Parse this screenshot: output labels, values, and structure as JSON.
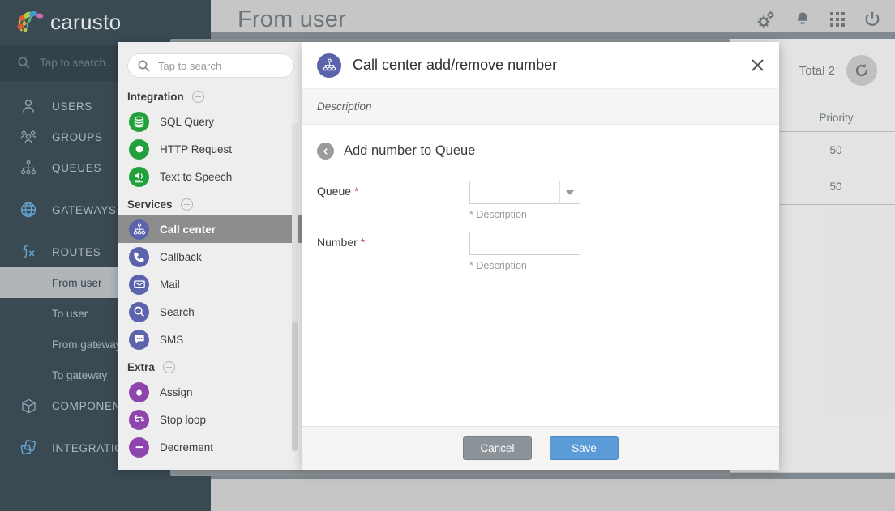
{
  "app": {
    "brand": "carusto",
    "nav_search_placeholder": "Tap to search..."
  },
  "sidebar": {
    "items": [
      {
        "label": "USERS",
        "icon": "user-icon"
      },
      {
        "label": "GROUPS",
        "icon": "group-icon"
      },
      {
        "label": "QUEUES",
        "icon": "queues-icon"
      },
      {
        "label": "GATEWAYS",
        "icon": "globe-icon"
      },
      {
        "label": "ROUTES",
        "icon": "fx-icon"
      }
    ],
    "route_children": [
      {
        "label": "From user",
        "active": true
      },
      {
        "label": "To user",
        "active": false
      },
      {
        "label": "From gateway",
        "active": false
      },
      {
        "label": "To gateway",
        "active": false
      }
    ],
    "lower_items": [
      {
        "label": "COMPONENTS",
        "icon": "cube-icon"
      },
      {
        "label": "INTEGRATION",
        "icon": "layers-icon"
      }
    ]
  },
  "page": {
    "title": "From user",
    "total_label": "Total 2",
    "refresh_icon": "refresh-icon",
    "topbar_icons": [
      "settings-gears-icon",
      "bell-icon",
      "apps-grid-icon",
      "power-icon"
    ],
    "table": {
      "column": "Priority",
      "rows": [
        "50",
        "50"
      ]
    }
  },
  "picker": {
    "search_placeholder": "Tap to search",
    "groups": [
      {
        "title": "Integration",
        "color": "#22a03c",
        "items": [
          {
            "label": "SQL Query",
            "icon": "database-icon"
          },
          {
            "label": "HTTP Request",
            "icon": "circle-dot-icon"
          },
          {
            "label": "Text to Speech",
            "icon": "speaker-icon"
          }
        ]
      },
      {
        "title": "Services",
        "color": "#5b63ac",
        "items": [
          {
            "label": "Call center",
            "icon": "call-center-icon",
            "selected": true
          },
          {
            "label": "Callback",
            "icon": "phone-icon",
            "selected": false
          },
          {
            "label": "Mail",
            "icon": "envelope-icon",
            "selected": false
          },
          {
            "label": "Search",
            "icon": "search-icon",
            "selected": false
          },
          {
            "label": "SMS",
            "icon": "chat-icon",
            "selected": false
          }
        ]
      },
      {
        "title": "Extra",
        "color": "#8e44ad",
        "items": [
          {
            "label": "Assign",
            "icon": "flame-icon"
          },
          {
            "label": "Stop loop",
            "icon": "stop-loop-icon"
          },
          {
            "label": "Decrement",
            "icon": "minus-icon"
          }
        ]
      }
    ]
  },
  "dialog": {
    "icon": "call-center-icon",
    "title": "Call center add/remove number",
    "close_icon": "close-icon",
    "description": "Description",
    "section": {
      "back_icon": "back-arrow-icon",
      "title": "Add number to Queue"
    },
    "fields": [
      {
        "label": "Queue",
        "required_mark": "*",
        "type": "select",
        "value": "",
        "hint": "* Description",
        "caret_icon": "chevron-down-icon"
      },
      {
        "label": "Number",
        "required_mark": "*",
        "type": "text",
        "value": "",
        "placeholder": "",
        "hint": "* Description"
      }
    ],
    "buttons": {
      "cancel": "Cancel",
      "save": "Save"
    }
  },
  "colors": {
    "nav_bg": "#34444c",
    "accent_blue": "#5b9bd8",
    "integration_green": "#22a03c",
    "services_purple": "#5b63ac",
    "extra_purple": "#8e44ad",
    "cancel_gray": "#8d9499"
  }
}
